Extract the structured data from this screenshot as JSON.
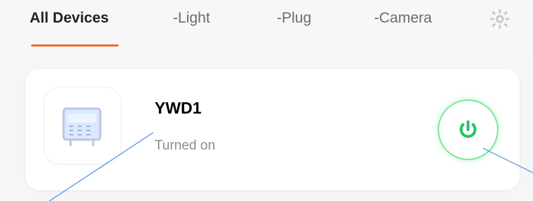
{
  "tabs": [
    {
      "label": "All Devices",
      "active": true
    },
    {
      "label": "-Light",
      "active": false
    },
    {
      "label": "-Plug",
      "active": false
    },
    {
      "label": "-Camera",
      "active": false
    }
  ],
  "tab_indicator_color": "#ef6a2b",
  "settings_icon": "gear-icon",
  "device": {
    "name": "YWD1",
    "status": "Turned on",
    "icon": "fridge-icon",
    "power_state": "on",
    "power_accent_color": "#22c55e"
  }
}
